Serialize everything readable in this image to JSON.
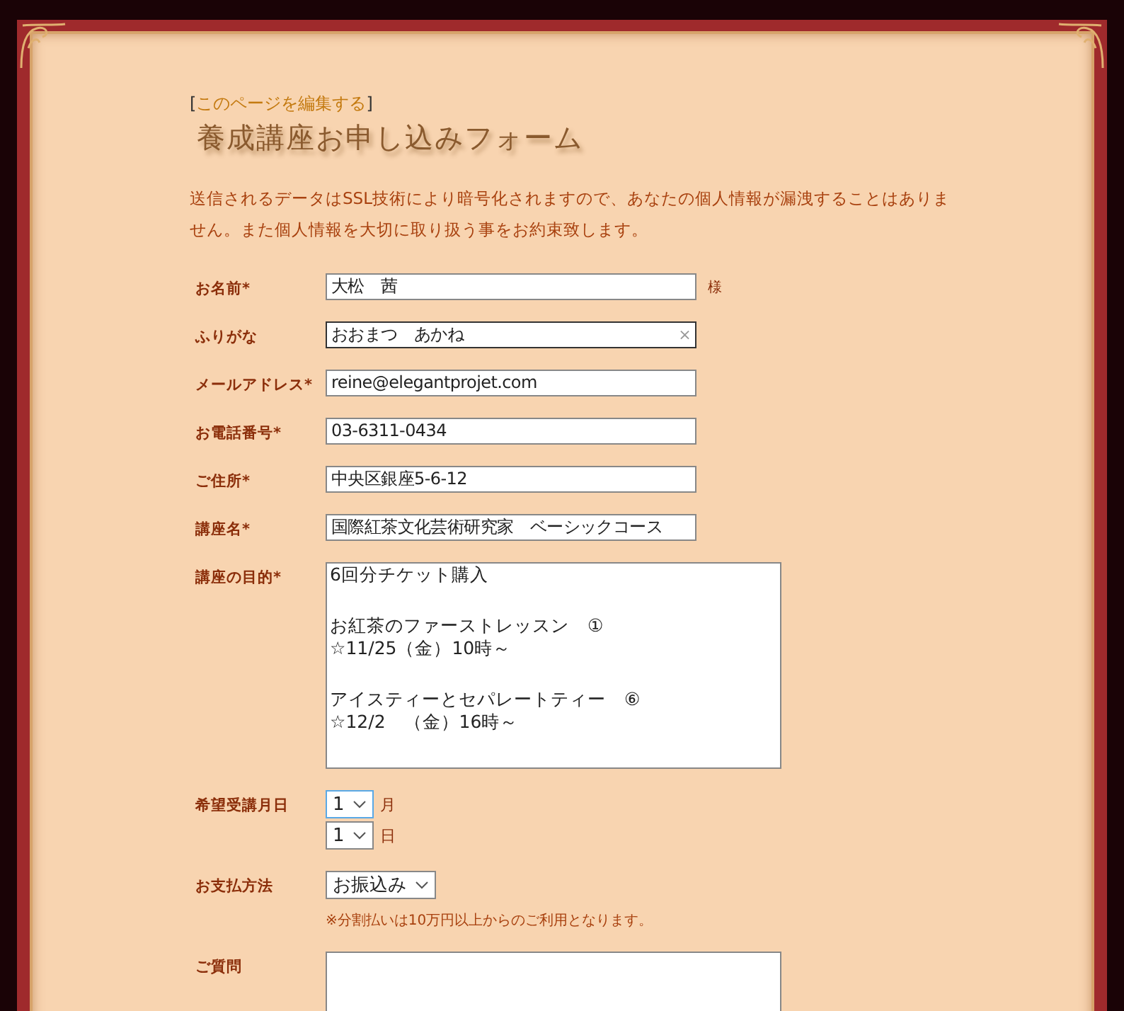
{
  "edit_link": {
    "open": "[",
    "label": "このページを編集する",
    "close": "]"
  },
  "title": "養成講座お申し込みフォーム",
  "notice": "送信されるデータはSSL技術により暗号化されますので、あなたの個人情報が漏洩することはありません。また個人情報を大切に取り扱う事をお約束致します。",
  "fields": [
    {
      "kind": "text",
      "label": "お名前*",
      "value": "大松　茜",
      "suffix": "様",
      "focused": false
    },
    {
      "kind": "text",
      "label": "ふりがな",
      "value": "おおまつ　あかね",
      "clear_glyph": "×",
      "focused": true
    },
    {
      "kind": "text",
      "label": "メールアドレス*",
      "value": "reine@elegantprojet.com",
      "focused": false
    },
    {
      "kind": "text",
      "label": "お電話番号*",
      "value": "03-6311-0434",
      "focused": false
    },
    {
      "kind": "text",
      "label": "ご住所*",
      "value": "中央区銀座5-6-12",
      "focused": false
    },
    {
      "kind": "text",
      "label": "講座名*",
      "value": "国際紅茶文化芸術研究家　ベーシックコース",
      "focused": false
    },
    {
      "kind": "textarea",
      "label": "講座の目的*",
      "paragraphs": [
        [
          "6回分チケット購入"
        ],
        [
          "お紅茶のファーストレッスン　①",
          "☆11/25（金）10時～"
        ],
        [
          "アイスティーとセパレートティー　⑥",
          "☆12/2　（金）16時～"
        ]
      ],
      "focused": false
    },
    {
      "kind": "date",
      "label": "希望受講月日",
      "selects": [
        {
          "value": "1",
          "unit": "月",
          "focused": true
        },
        {
          "value": "1",
          "unit": "日",
          "focused": false
        }
      ]
    },
    {
      "kind": "select",
      "label": "お支払方法",
      "value": "お振込み",
      "note": "※分割払いは10万円以上からのご利用となります。",
      "focused": false
    },
    {
      "kind": "textarea",
      "label": "ご質問",
      "focused": false
    }
  ]
}
